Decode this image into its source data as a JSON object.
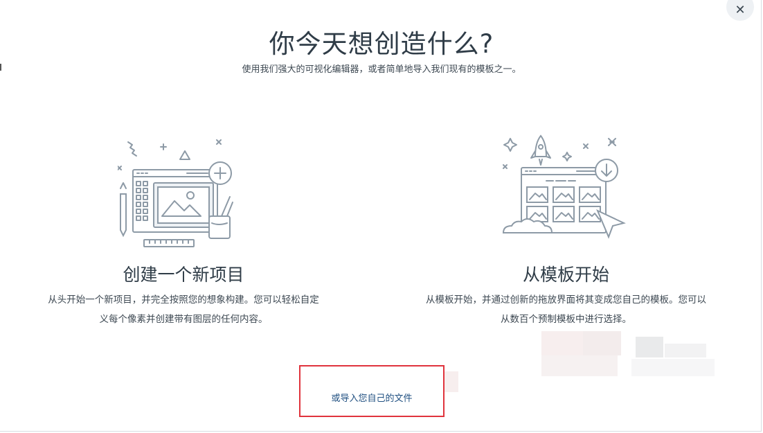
{
  "dialog": {
    "title": "你今天想创造什么?",
    "subtitle": "使用我们强大的可视化编辑器，或者简单地导入我们现有的模板之一。",
    "close_icon": "✕"
  },
  "options": [
    {
      "icon": "design-canvas-icon",
      "title": "创建一个新项目",
      "description": "从头开始一个新项目，并完全按照您的想象构建。您可以轻松自定义每个像素并创建带有图层的任何内容。"
    },
    {
      "icon": "template-grid-icon",
      "title": "从模板开始",
      "description": "从模板开始，并通过创新的拖放界面将其变成您自己的模板。您可以从数百个预制模板中进行选择。"
    }
  ],
  "import": {
    "label": "或导入您自己的文件",
    "highlight_color": "#e0333c"
  },
  "colors": {
    "text": "#2f3c47",
    "link": "#1f4f80",
    "illustration_stroke": "#8d9aa6"
  }
}
